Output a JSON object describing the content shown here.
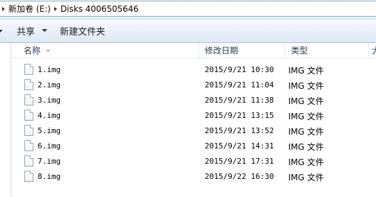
{
  "address": {
    "crumbs": [
      "新加卷 (E:)",
      "Disks 4006505646"
    ]
  },
  "toolbar": {
    "share_label": "共享",
    "new_folder_label": "新建文件夹"
  },
  "columns": {
    "name": "名称",
    "date": "修改日期",
    "type": "类型",
    "size": "大"
  },
  "files": [
    {
      "name": "1.img",
      "date": "2015/9/21 10:30",
      "type": "IMG 文件"
    },
    {
      "name": "2.img",
      "date": "2015/9/21 11:04",
      "type": "IMG 文件"
    },
    {
      "name": "3.img",
      "date": "2015/9/21 11:38",
      "type": "IMG 文件"
    },
    {
      "name": "4.img",
      "date": "2015/9/21 13:15",
      "type": "IMG 文件"
    },
    {
      "name": "5.img",
      "date": "2015/9/21 13:52",
      "type": "IMG 文件"
    },
    {
      "name": "6.img",
      "date": "2015/9/21 14:31",
      "type": "IMG 文件"
    },
    {
      "name": "7.img",
      "date": "2015/9/21 17:31",
      "type": "IMG 文件"
    },
    {
      "name": "8.img",
      "date": "2015/9/22 16:30",
      "type": "IMG 文件"
    }
  ]
}
